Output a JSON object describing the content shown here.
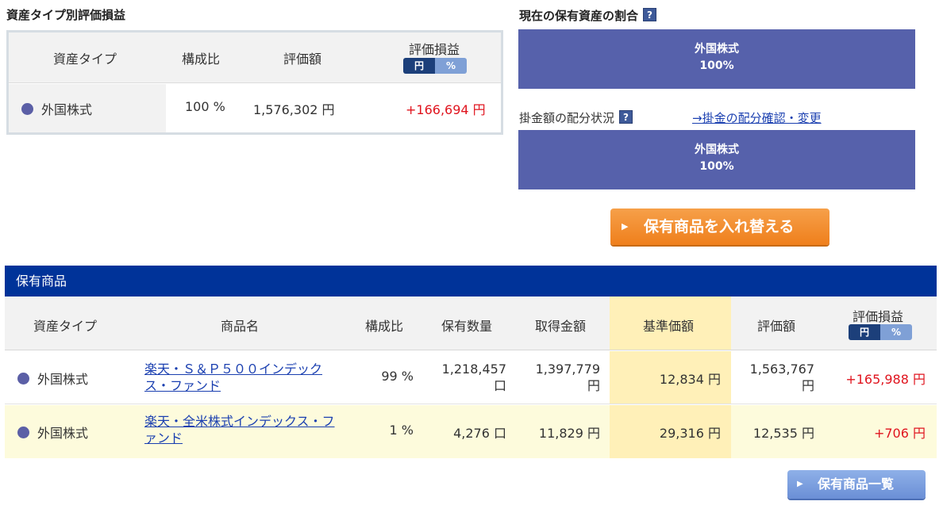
{
  "summary": {
    "title": "資産タイプ別評価損益",
    "headers": {
      "type": "資産タイプ",
      "ratio": "構成比",
      "value": "評価額",
      "pl": "評価損益"
    },
    "toggle": {
      "yen": "円",
      "pct": "%"
    },
    "row": {
      "type": "外国株式",
      "ratio": "100 %",
      "value": "1,576,302 円",
      "pl": "+166,694 円"
    }
  },
  "allocation": {
    "current_title": "現在の保有資産の割合",
    "current_bar": {
      "label": "外国株式",
      "value": "100%"
    },
    "contrib_title": "掛金額の配分状況",
    "contrib_link": "→掛金の配分確認・変更",
    "contrib_bar": {
      "label": "外国株式",
      "value": "100%"
    },
    "help_glyph": "?"
  },
  "switch_button": "保有商品を入れ替える",
  "holdings": {
    "title": "保有商品",
    "headers": {
      "type": "資産タイプ",
      "name": "商品名",
      "ratio": "構成比",
      "qty": "保有数量",
      "cost": "取得金額",
      "base": "基準価額",
      "value": "評価額",
      "pl": "評価損益"
    },
    "toggle": {
      "yen": "円",
      "pct": "%"
    },
    "rows": [
      {
        "type": "外国株式",
        "name_line1": "楽天・Ｓ＆Ｐ５００インデック",
        "name_line2": "ス・ファンド",
        "ratio": "99 %",
        "qty_line1": "1,218,457",
        "qty_line2": "口",
        "cost_line1": "1,397,779",
        "cost_line2": "円",
        "base": "12,834 円",
        "value_line1": "1,563,767",
        "value_line2": "円",
        "pl": "+165,988 円"
      },
      {
        "type": "外国株式",
        "name_line1": "楽天・全米株式インデックス・フ",
        "name_line2": "ァンド",
        "ratio": "1 %",
        "qty": "4,276 口",
        "cost": "11,829 円",
        "base": "29,316 円",
        "value": "12,535 円",
        "pl": "+706 円"
      }
    ]
  },
  "list_button": "保有商品一覧",
  "colors": {
    "navy": "#003399",
    "allocation_bar": "#5661ab",
    "profit_red": "#e0141e",
    "orange_button": "#ef7f1c",
    "highlight_yellow": "#fff0b8",
    "row_yellow": "#fdfbdc"
  },
  "icons": {
    "bullet": "dot-icon",
    "help": "help-icon",
    "arrow": "triangle-right-icon"
  }
}
